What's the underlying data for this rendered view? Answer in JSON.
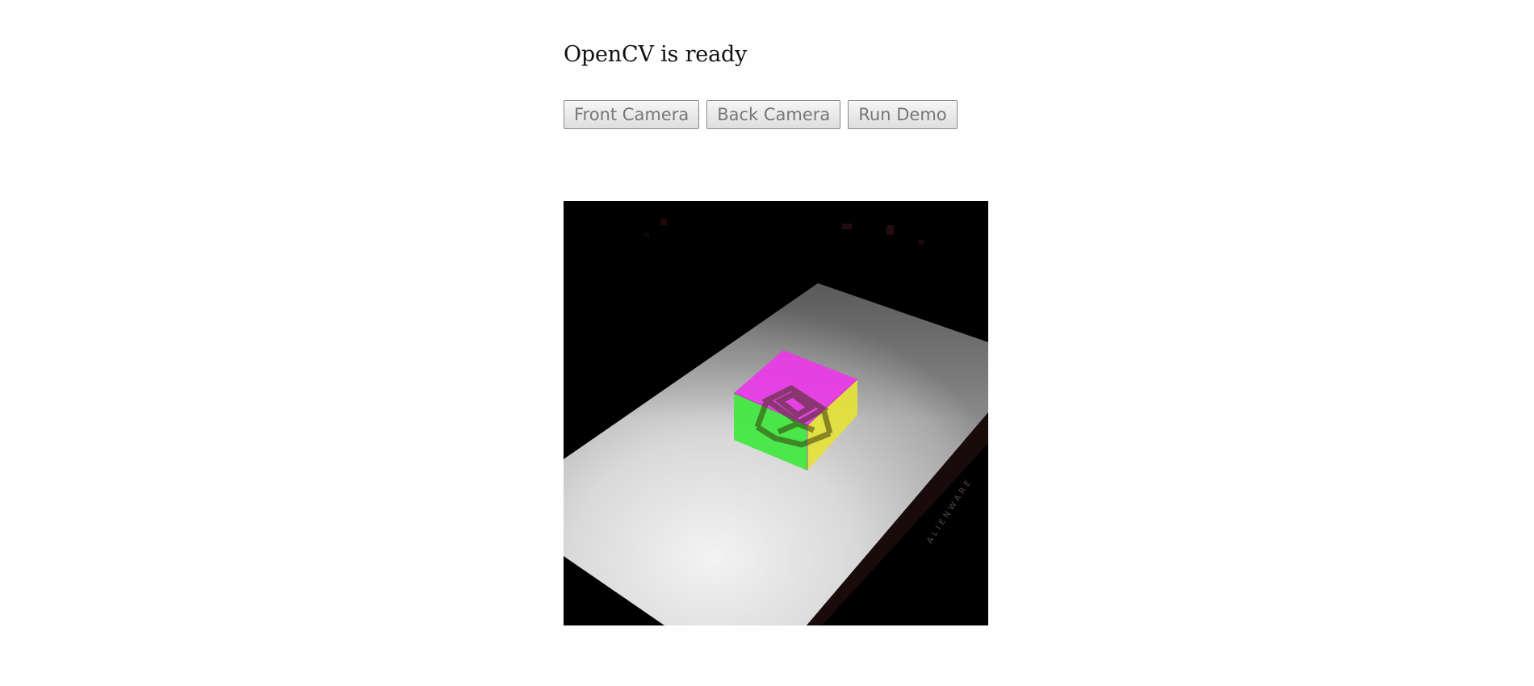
{
  "status": {
    "text": "OpenCV is ready"
  },
  "controls": {
    "front_camera_label": "Front Camera",
    "back_camera_label": "Back Camera",
    "run_demo_label": "Run Demo"
  },
  "camera_feed": {
    "monitor_brand_text": "ALIENWARE",
    "overlay_colors": {
      "top_face": "#e93be6",
      "left_face": "#3fe83f",
      "right_face": "#e4e23a"
    }
  }
}
